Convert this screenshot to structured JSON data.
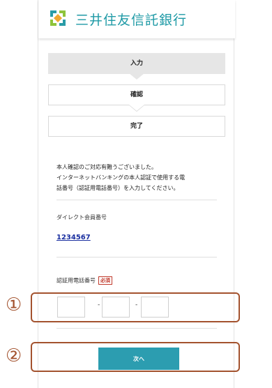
{
  "header": {
    "brand": "三井住友信託銀行"
  },
  "steps": [
    {
      "label": "入力"
    },
    {
      "label": "確認"
    },
    {
      "label": "完了"
    }
  ],
  "message": {
    "line1": "本人確認のご対応有難うございました。",
    "line2": "インターネットバンキングの本人認証で使用する電",
    "line3": "話番号（認証用電話番号）を入力してください。"
  },
  "direct_member": {
    "label": "ダイレクト会員番号",
    "value": "1234567"
  },
  "auth_phone": {
    "label": "認証用電話番号",
    "required": "必須",
    "part1": "",
    "part2": "",
    "part3": "",
    "separator": "-"
  },
  "next_button": {
    "label": "次へ"
  },
  "callouts": [
    {
      "number": "①"
    },
    {
      "number": "②"
    }
  ],
  "colors": {
    "brand": "#1f9aa6",
    "button": "#2c9db0",
    "required": "#c0392b",
    "callout": "#a3522e",
    "link": "#1a2fa0"
  }
}
